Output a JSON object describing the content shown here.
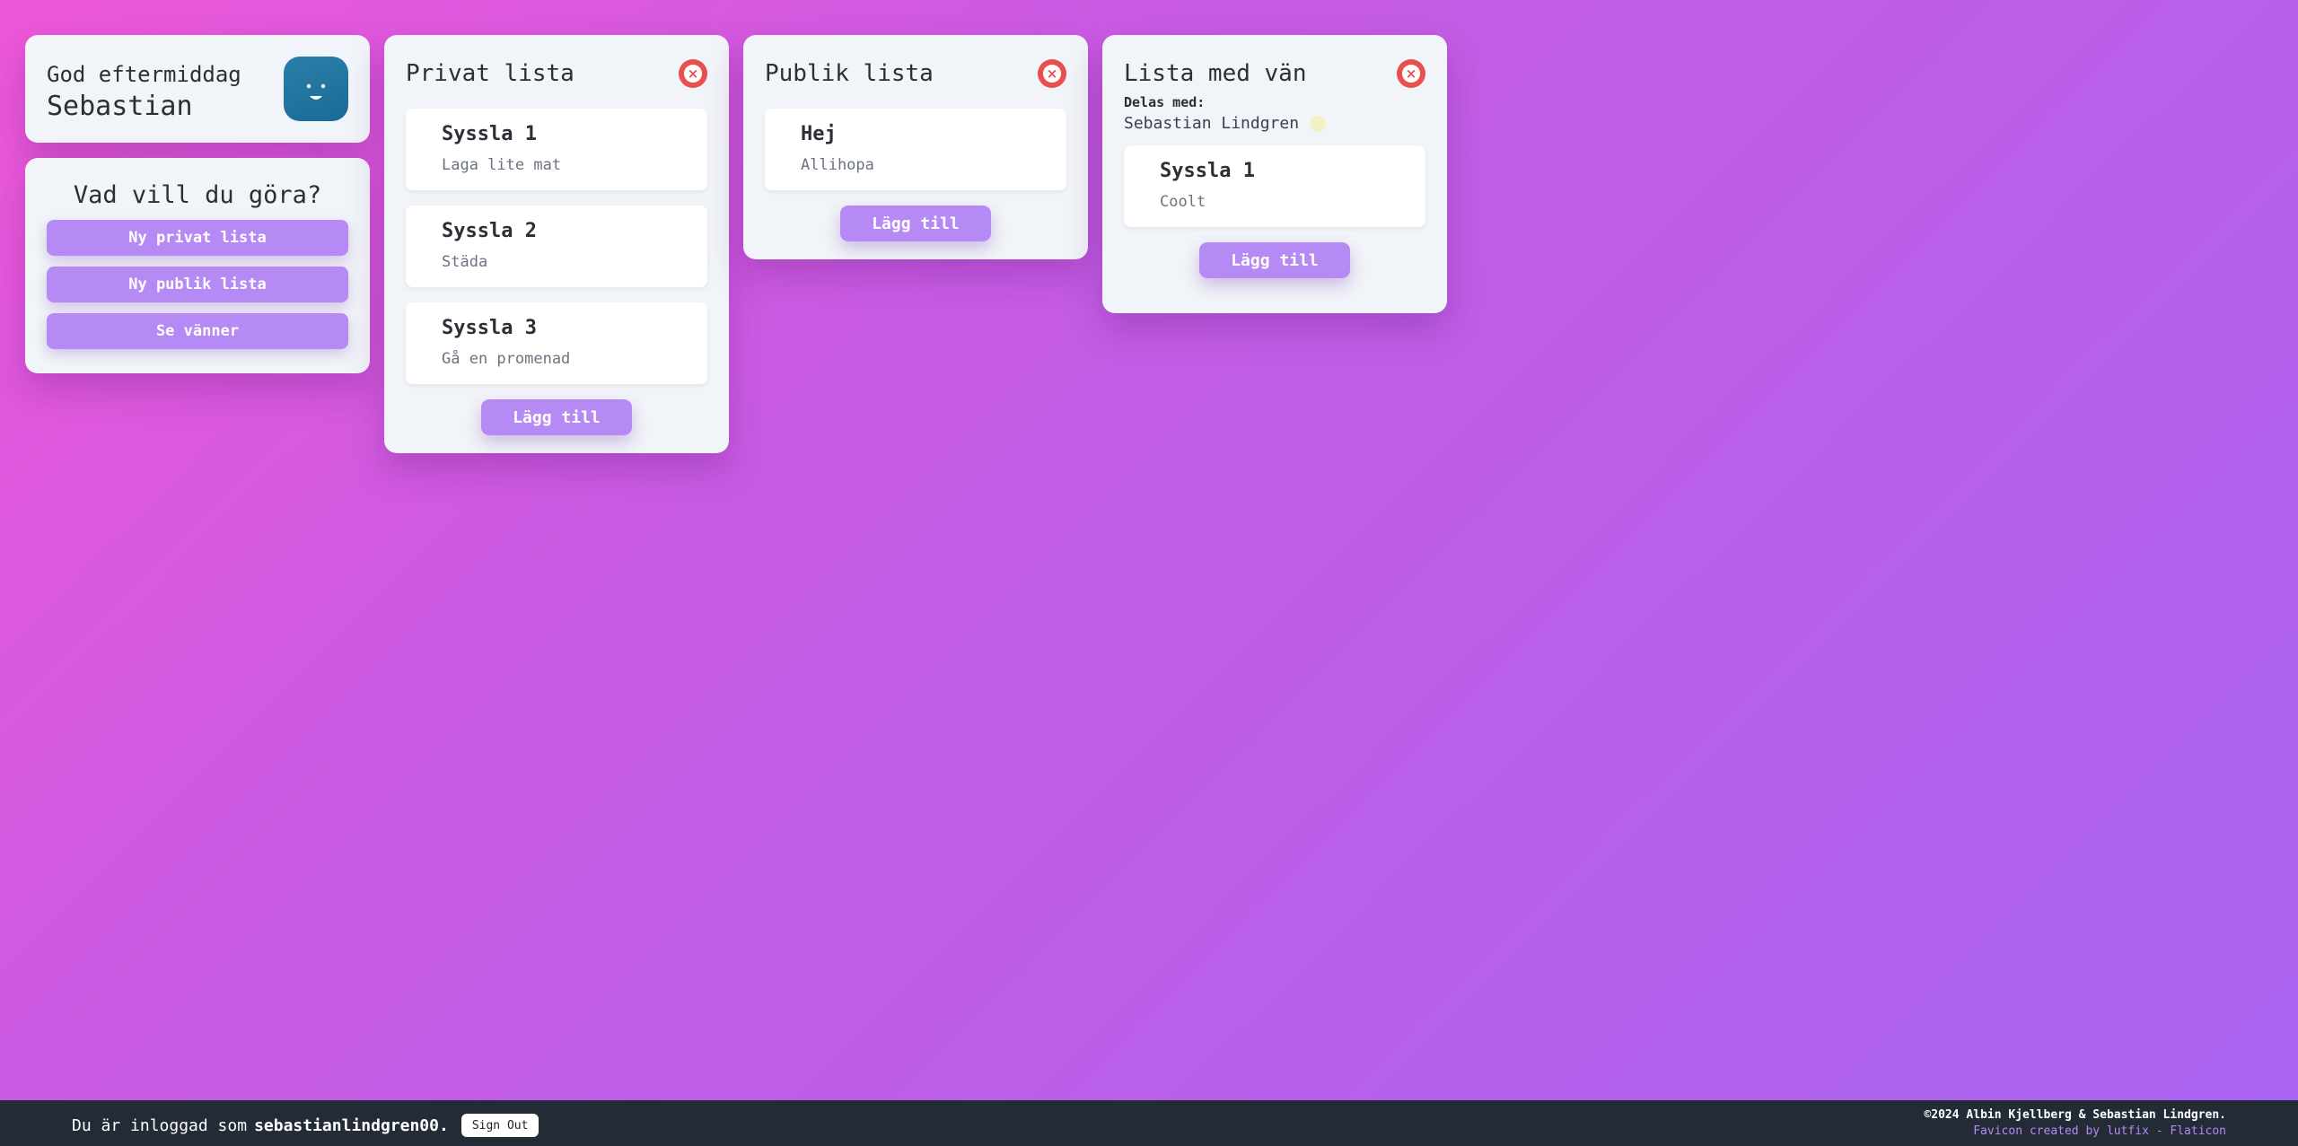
{
  "greeting": {
    "line1": "God eftermiddag",
    "name": "Sebastian",
    "avatar_icon": "smiley-icon",
    "avatar_color": "#1f76a0"
  },
  "actions": {
    "title": "Vad vill du göra?",
    "buttons": [
      "Ny privat lista",
      "Ny publik lista",
      "Se vänner"
    ]
  },
  "lists": {
    "private": {
      "title": "Privat lista",
      "tasks": [
        {
          "title": "Syssla 1",
          "desc": "Laga lite mat"
        },
        {
          "title": "Syssla 2",
          "desc": "Städa"
        },
        {
          "title": "Syssla 3",
          "desc": "Gå en promenad"
        }
      ],
      "add_label": "Lägg till"
    },
    "public": {
      "title": "Publik lista",
      "tasks": [
        {
          "title": "Hej",
          "desc": "Allihopa"
        }
      ],
      "add_label": "Lägg till"
    },
    "friend": {
      "title": "Lista med vän",
      "shared_label": "Delas med:",
      "shared_with": "Sebastian Lindgren",
      "tasks": [
        {
          "title": "Syssla 1",
          "desc": "Coolt"
        }
      ],
      "add_label": "Lägg till"
    }
  },
  "footer": {
    "login_prefix": "Du är inloggad som",
    "username": "sebastianlindgren00.",
    "signout_label": "Sign Out",
    "copyright": "©2024 Albin Kjellberg & Sebastian Lindgren.",
    "favicon_credit": "Favicon created by lutfix - Flaticon"
  },
  "colors": {
    "accent": "#b58af5",
    "close": "#ea4f4f",
    "footer_bg": "#222b36"
  }
}
